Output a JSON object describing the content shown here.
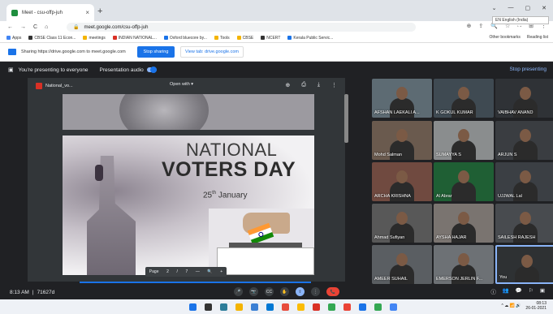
{
  "browser": {
    "tab_title": "Meet - csu-offp-juh",
    "tab_close": "×",
    "new_tab": "+",
    "window_controls": [
      "⌄",
      "—",
      "▢",
      "✕"
    ],
    "ime_tooltip": "EN English (India)",
    "nav": [
      "←",
      "→",
      "C",
      "⌂"
    ],
    "url": "meet.google.com/csu-offp-juh",
    "toolbar_icons": [
      "⊕",
      "⇪",
      "🔍",
      "☆",
      "⛶",
      "⊞",
      "⋮"
    ]
  },
  "bookmarks": {
    "items": [
      {
        "label": "Apps",
        "color": "#4285f4"
      },
      {
        "label": "CBSE Class 11 Econ...",
        "color": "#333333"
      },
      {
        "label": "meetings",
        "color": "#f4b400"
      },
      {
        "label": "INDIAN NATIONAL...",
        "color": "#d93025"
      },
      {
        "label": "Oxford bluecore by...",
        "color": "#1a73e8"
      },
      {
        "label": "Tools",
        "color": "#f4b400"
      },
      {
        "label": "CBSE",
        "color": "#f4b400"
      },
      {
        "label": "NCERT",
        "color": "#333333"
      },
      {
        "label": "Kerala Public Servic...",
        "color": "#1a73e8"
      }
    ],
    "other": "Other bookmarks",
    "reading": "Reading list"
  },
  "sharing": {
    "text": "Sharing https://drive.google.com to meet.google.com",
    "stop_button": "Stop sharing",
    "view_tab": "View tab: drive.google.com"
  },
  "presenting": {
    "text": "You're presenting to everyone",
    "audio": "Presentation audio",
    "stop": "Stop presenting"
  },
  "pdf": {
    "file_name": "National_vo... ",
    "open_with": "Open with ▾",
    "tools": [
      "⊕",
      "⎙",
      "⤓",
      "⋮"
    ],
    "slide_title_1": "NATIONAL",
    "slide_title_2": "VOTERS DAY",
    "slide_date_num": "25",
    "slide_date_sup": "th",
    "slide_date_month": "January",
    "page_controls": [
      "Page",
      "2",
      "/",
      "7",
      "—",
      "🔍",
      "+"
    ]
  },
  "participants": [
    {
      "name": "AFSHAN LAEKALI A..."
    },
    {
      "name": "K GOKUL KUMAR"
    },
    {
      "name": "VAIBHAV ANAND"
    },
    {
      "name": "Mohd Salman"
    },
    {
      "name": "SUMAYYA S"
    },
    {
      "name": "ARJUN S"
    },
    {
      "name": "ARCHA KRISHNA"
    },
    {
      "name": "Al Abrar"
    },
    {
      "name": "UJJWAL Lal"
    },
    {
      "name": "Ahmad Sufiyan"
    },
    {
      "name": "AYSHA HAJAR"
    },
    {
      "name": "SAILESH RAJESH"
    },
    {
      "name": "AMEER SUHAIL"
    },
    {
      "name": "EMERSON JERLIN F..."
    },
    {
      "name": "You"
    }
  ],
  "meeting": {
    "time": "8:13 AM",
    "separator": "|",
    "code": "71627d",
    "controls": [
      "🎤",
      "📷",
      "CC",
      "✋",
      "⇧",
      "⋮",
      "📞"
    ],
    "right_controls": [
      "ⓘ",
      "👥",
      "💬",
      "⚐",
      "▣"
    ]
  },
  "taskbar": {
    "apps": [
      "#1a73e8",
      "#333333",
      "#2d7d9a",
      "#f4b400",
      "#3b7fd4",
      "#0078d4",
      "#e74c3c",
      "#fbbc05",
      "#d93025",
      "#34a853",
      "#ea4335",
      "#1a73e8",
      "#34a853",
      "#4285f4"
    ],
    "tray_icons": "^ ☁ 📶 🔊",
    "tray_time": "08:13",
    "tray_date": "26-01-2021"
  }
}
